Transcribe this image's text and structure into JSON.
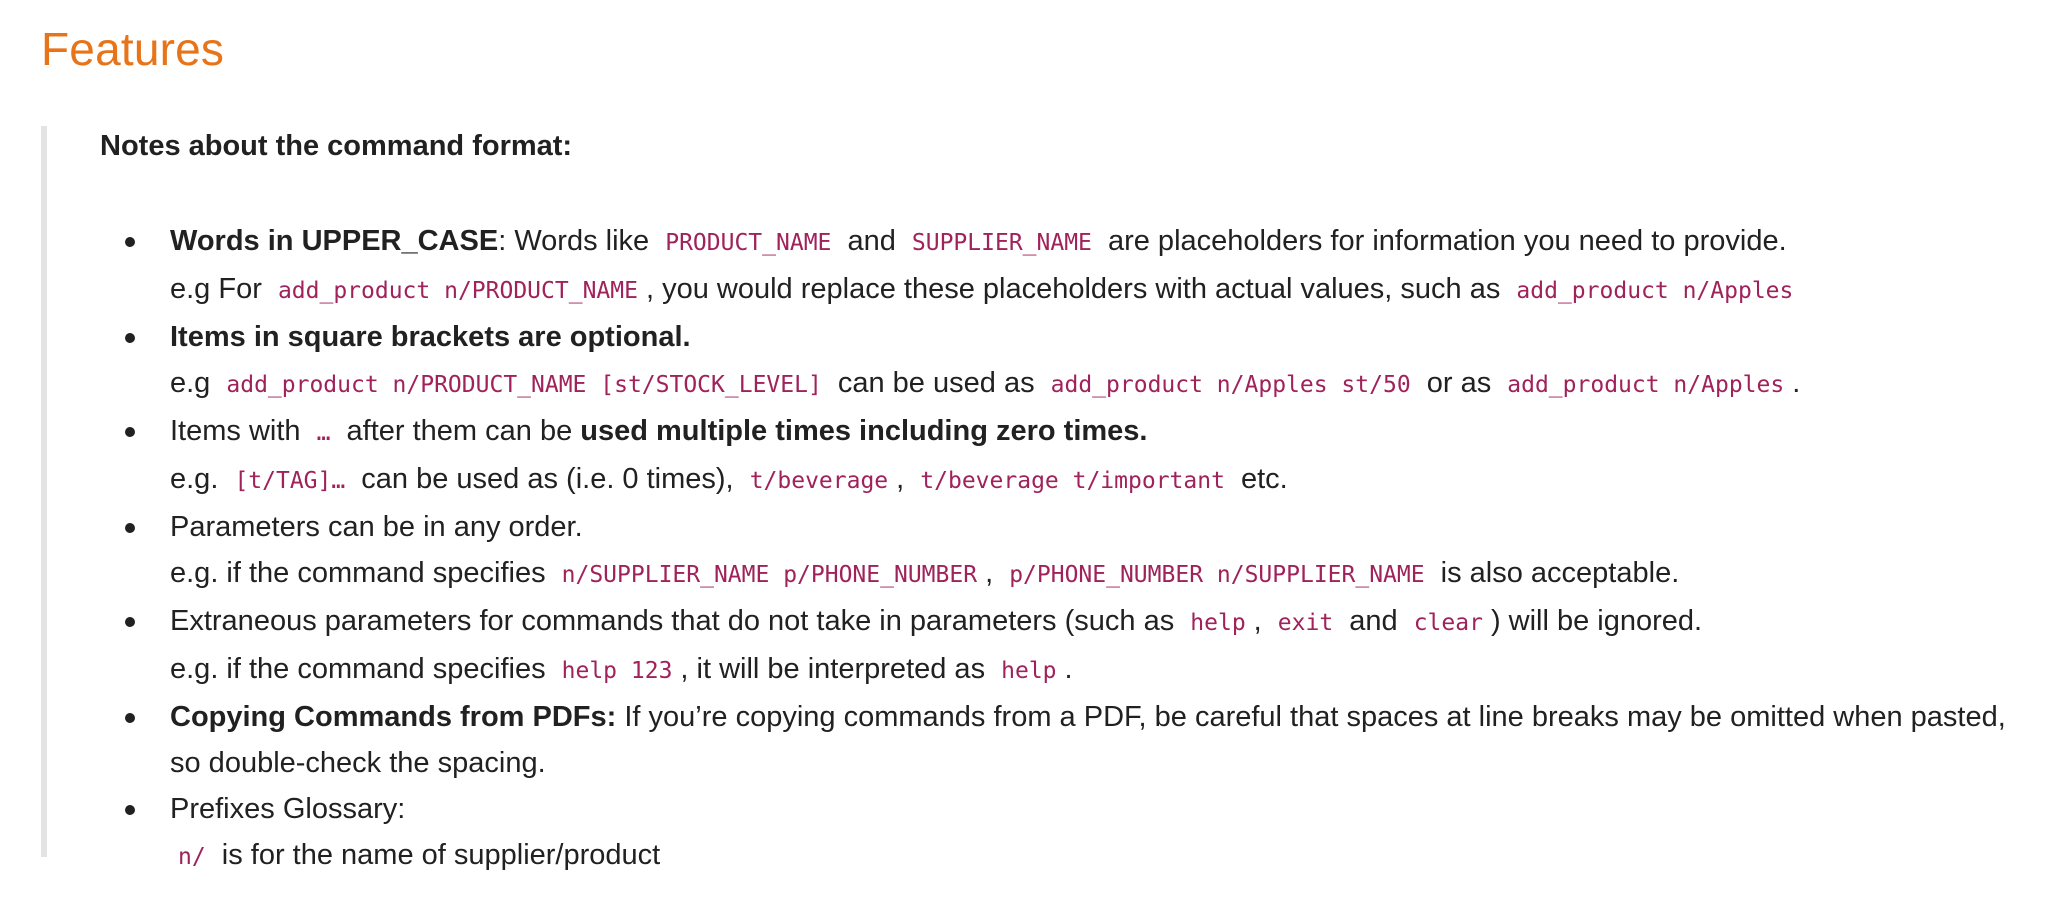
{
  "heading": "Features",
  "notes_title": "Notes about the command format:",
  "items": [
    {
      "line1": {
        "bold": "Words in UPPER_CASE",
        "t1": ": Words like ",
        "c1": "PRODUCT_NAME",
        "t2": " and ",
        "c2": "SUPPLIER_NAME",
        "t3": " are placeholders for information you need to provide."
      },
      "line2": {
        "t1": "e.g For ",
        "c1": "add_product n/PRODUCT_NAME",
        "t2": ", you would replace these placeholders with actual values, such as ",
        "c2": "add_product n/Apples"
      }
    },
    {
      "line1": {
        "bold": "Items in square brackets are optional."
      },
      "line2": {
        "t1": "e.g ",
        "c1": "add_product n/PRODUCT_NAME [st/STOCK_LEVEL]",
        "t2": " can be used as ",
        "c2": "add_product n/Apples st/50",
        "t3": " or as ",
        "c3": "add_product n/Apples",
        "t4": "."
      }
    },
    {
      "line1": {
        "t1": "Items with ",
        "c1": "…",
        "t2": " after them can be ",
        "bold": "used multiple times including zero times."
      },
      "line2": {
        "t1": "e.g. ",
        "c1": "[t/TAG]…",
        "t2": " can be used as   (i.e. 0 times), ",
        "c2": "t/beverage",
        "t3": ", ",
        "c3": "t/beverage t/important",
        "t4": " etc."
      }
    },
    {
      "line1": {
        "t1": "Parameters can be in any order."
      },
      "line2": {
        "t1": "e.g. if the command specifies ",
        "c1": "n/SUPPLIER_NAME p/PHONE_NUMBER",
        "t2": ", ",
        "c2": "p/PHONE_NUMBER n/SUPPLIER_NAME",
        "t3": " is also acceptable."
      }
    },
    {
      "line1": {
        "t1": "Extraneous parameters for commands that do not take in parameters (such as ",
        "c1": "help",
        "t2": ", ",
        "c2": "exit",
        "t3": " and ",
        "c3": "clear",
        "t4": ") will be ignored."
      },
      "line2": {
        "t1": "e.g. if the command specifies ",
        "c1": "help 123",
        "t2": ", it will be interpreted as ",
        "c2": "help",
        "t3": "."
      }
    },
    {
      "line1": {
        "bold": "Copying Commands from PDFs:",
        "t1": " If you’re copying commands from a PDF, be careful that spaces at line breaks may be omitted when pasted, so double-check the spacing."
      }
    },
    {
      "line1": {
        "t1": "Prefixes Glossary:"
      },
      "line2": {
        "c1": "n/",
        "t1": " is for the name of supplier/product"
      }
    }
  ]
}
